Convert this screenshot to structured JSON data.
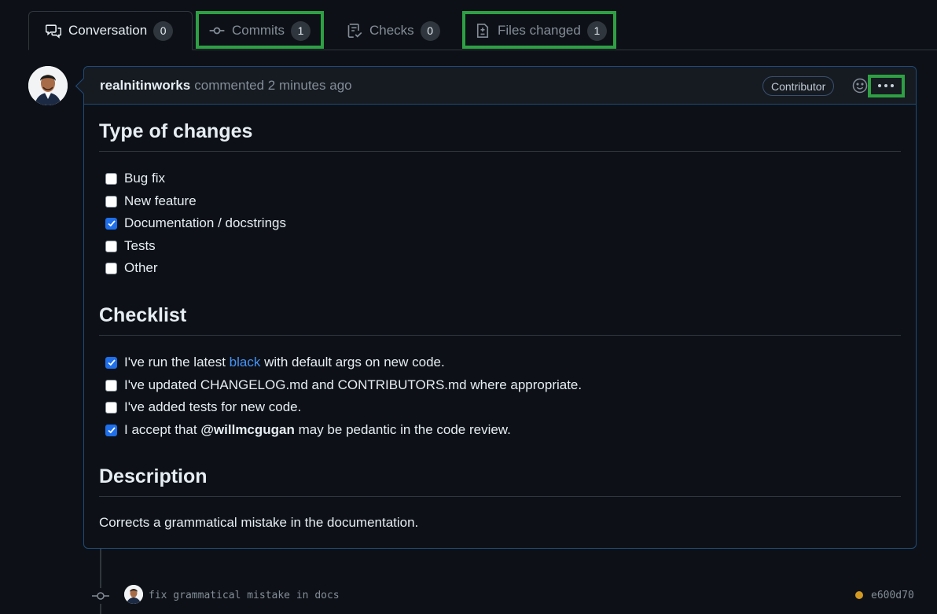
{
  "tabs": [
    {
      "label": "Conversation",
      "count": "0",
      "icon": "comment-discussion-icon",
      "active": true
    },
    {
      "label": "Commits",
      "count": "1",
      "icon": "git-commit-icon"
    },
    {
      "label": "Checks",
      "count": "0",
      "icon": "checklist-icon"
    },
    {
      "label": "Files changed",
      "count": "1",
      "icon": "file-diff-icon"
    }
  ],
  "comment": {
    "author": "realnitinworks",
    "meta": "commented 2 minutes ago",
    "badge": "Contributor",
    "sections": {
      "type_heading": "Type of changes",
      "type_items": [
        {
          "label": "Bug fix",
          "checked": false
        },
        {
          "label": "New feature",
          "checked": false
        },
        {
          "label": "Documentation / docstrings",
          "checked": true
        },
        {
          "label": "Tests",
          "checked": false
        },
        {
          "label": "Other",
          "checked": false
        }
      ],
      "checklist_heading": "Checklist",
      "checklist": {
        "item1_pre": "I've run the latest ",
        "item1_link": "black",
        "item1_post": " with default args on new code.",
        "item2": "I've updated CHANGELOG.md and CONTRIBUTORS.md where appropriate.",
        "item3": "I've added tests for new code.",
        "item4_pre": "I accept that ",
        "item4_mention": "@willmcgugan",
        "item4_post": " may be pedantic in the code review.",
        "checked": [
          true,
          false,
          false,
          true
        ]
      },
      "description_heading": "Description",
      "description_text": "Corrects a grammatical mistake in the documentation."
    }
  },
  "timeline": {
    "commit_message": "fix grammatical mistake in docs",
    "commit_sha": "e600d70",
    "status_color": "#d29922"
  },
  "colors": {
    "highlight": "#2ea043",
    "link": "#4493f8",
    "checkbox_checked": "#1f6feb"
  }
}
